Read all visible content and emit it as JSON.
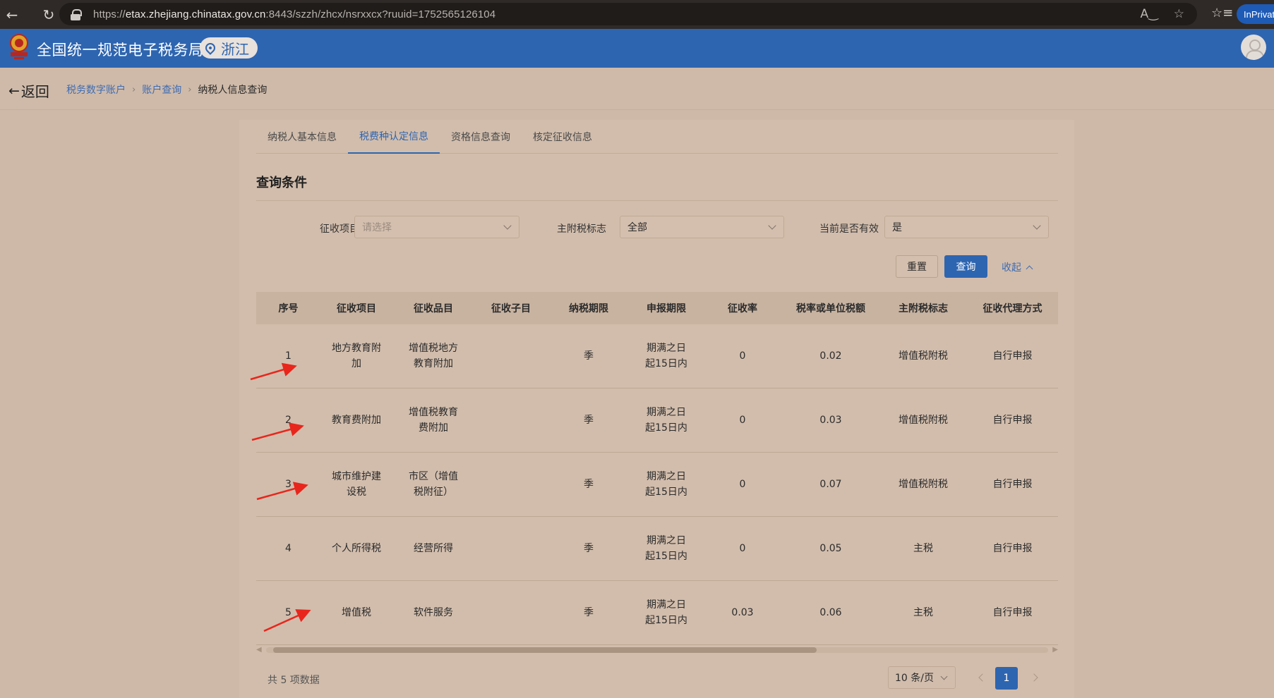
{
  "browser": {
    "url_prefix": "https://",
    "url_host": "etax.zhejiang.chinatax.gov.cn",
    "url_path": ":8443/szzh/zhcx/nsrxxcx?ruuid=1752565126104",
    "inprivate_label": "InPrivate"
  },
  "header": {
    "app_title": "全国统一规范电子税务局",
    "region": "浙江",
    "brand_color": "#2e65b0"
  },
  "nav": {
    "back_label": "返回",
    "breadcrumb": [
      "税务数字账户",
      "账户查询",
      "纳税人信息查询"
    ]
  },
  "tabs": [
    {
      "label": "纳税人基本信息",
      "active": false
    },
    {
      "label": "税费种认定信息",
      "active": true
    },
    {
      "label": "资格信息查询",
      "active": false
    },
    {
      "label": "核定征收信息",
      "active": false
    }
  ],
  "query": {
    "title": "查询条件",
    "fields": [
      {
        "label": "征收项目",
        "value": "",
        "placeholder": "请选择"
      },
      {
        "label": "主附税标志",
        "value": "全部"
      },
      {
        "label": "当前是否有效",
        "value": "是"
      }
    ],
    "reset_label": "重置",
    "query_label": "查询",
    "collapse_label": "收起"
  },
  "table": {
    "columns": [
      "序号",
      "征收项目",
      "征收品目",
      "征收子目",
      "纳税期限",
      "申报期限",
      "征收率",
      "税率或单位税额",
      "主附税标志",
      "征收代理方式"
    ],
    "rows": [
      [
        "1",
        "地方教育附加",
        "增值税地方教育附加",
        "",
        "季",
        "期满之日起15日内",
        "0",
        "0.02",
        "增值税附税",
        "自行申报"
      ],
      [
        "2",
        "教育费附加",
        "增值税教育费附加",
        "",
        "季",
        "期满之日起15日内",
        "0",
        "0.03",
        "增值税附税",
        "自行申报"
      ],
      [
        "3",
        "城市维护建设税",
        "市区（增值税附征）",
        "",
        "季",
        "期满之日起15日内",
        "0",
        "0.07",
        "增值税附税",
        "自行申报"
      ],
      [
        "4",
        "个人所得税",
        "经营所得",
        "",
        "季",
        "期满之日起15日内",
        "0",
        "0.05",
        "主税",
        "自行申报"
      ],
      [
        "5",
        "增值税",
        "软件服务",
        "",
        "季",
        "期满之日起15日内",
        "0.03",
        "0.06",
        "主税",
        "自行申报"
      ]
    ]
  },
  "footer": {
    "total": "共 5 项数据",
    "page_size": "10 条/页",
    "current_page": "1"
  }
}
